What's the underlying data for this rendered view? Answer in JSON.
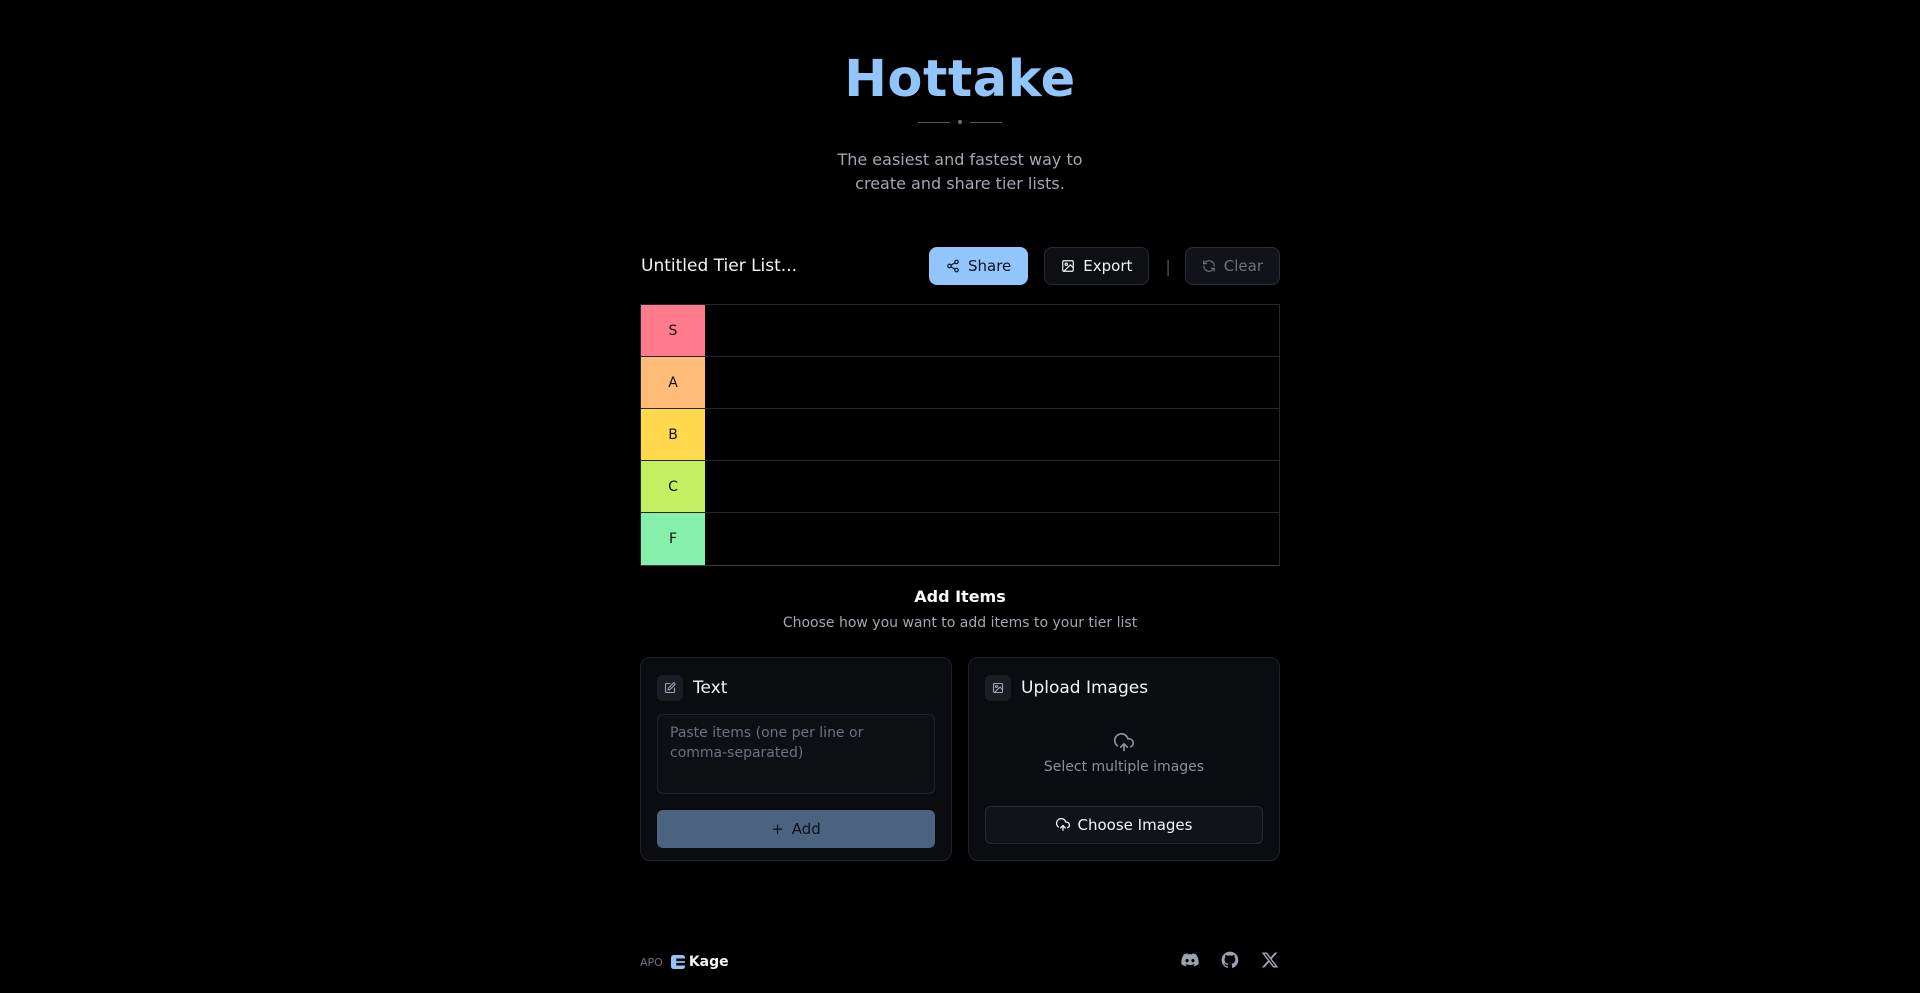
{
  "hero": {
    "title": "Hottake",
    "subtitle": "The easiest and fastest way to create and share tier lists."
  },
  "toolbar": {
    "list_title": "Untitled Tier List...",
    "share_label": "Share",
    "export_label": "Export",
    "separator": "|",
    "clear_label": "Clear"
  },
  "tiers": [
    {
      "label": "S",
      "color": "#ff7a8d"
    },
    {
      "label": "A",
      "color": "#ffbb78"
    },
    {
      "label": "B",
      "color": "#ffd84d"
    },
    {
      "label": "C",
      "color": "#c5ef62"
    },
    {
      "label": "F",
      "color": "#86efac"
    }
  ],
  "add_items": {
    "title": "Add Items",
    "subtitle": "Choose how you want to add items to your tier list"
  },
  "text_card": {
    "title": "Text",
    "placeholder": "Paste items (one per line or comma-separated)",
    "value": "",
    "add_label": "Add",
    "icon": "edit-icon"
  },
  "upload_card": {
    "title": "Upload Images",
    "hint": "Select multiple images",
    "choose_label": "Choose Images",
    "icon": "image-icon"
  },
  "footer": {
    "prefix": "APO",
    "brand": "Kage",
    "socials": [
      "discord-icon",
      "github-icon",
      "x-icon"
    ]
  },
  "colors": {
    "accent": "#93c5fd",
    "background": "#000000"
  }
}
